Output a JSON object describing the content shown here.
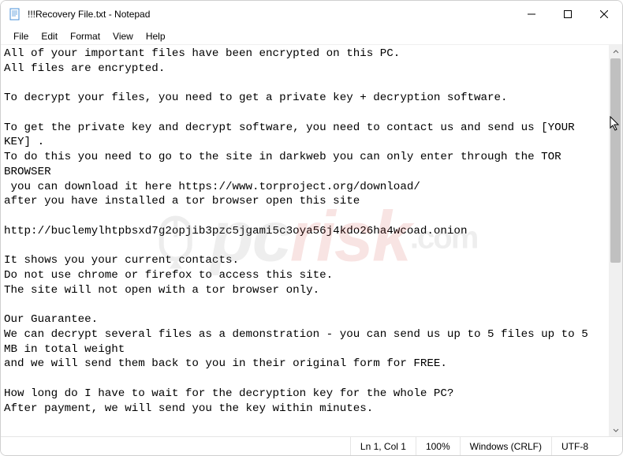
{
  "title": "!!!Recovery File.txt - Notepad",
  "menu": {
    "file": "File",
    "edit": "Edit",
    "format": "Format",
    "view": "View",
    "help": "Help"
  },
  "body_text": "All of your important files have been encrypted on this PC.\nAll files are encrypted.\n\nTo decrypt your files, you need to get a private key + decryption software.\n\nTo get the private key and decrypt software, you need to contact us and send us [YOUR KEY] .\nTo do this you need to go to the site in darkweb you can only enter through the TOR BROWSER\n you can download it here https://www.torproject.org/download/\nafter you have installed a tor browser open this site\n\nhttp://buclemylhtpbsxd7g2opjib3pzc5jgami5c3oya56j4kdo26ha4wcoad.onion\n\nIt shows you your current contacts.\nDo not use chrome or firefox to access this site.\nThe site will not open with a tor browser only.\n\nOur Guarantee.\nWe can decrypt several files as a demonstration - you can send us up to 5 files up to 5 MB in total weight\nand we will send them back to you in their original form for FREE.\n\nHow long do I have to wait for the decryption key for the whole PC?\nAfter payment, we will send you the key within minutes.",
  "status": {
    "position": "Ln 1, Col 1",
    "zoom": "100%",
    "line_ending": "Windows (CRLF)",
    "encoding": "UTF-8"
  },
  "watermark": {
    "p": "p",
    "c": "c",
    "risk": "risk",
    "com": ".com"
  },
  "icons": {
    "app": "notepad-icon",
    "minimize": "minimize-icon",
    "maximize": "maximize-icon",
    "close": "close-icon",
    "scroll_up": "chevron-up-icon",
    "scroll_down": "chevron-down-icon"
  }
}
